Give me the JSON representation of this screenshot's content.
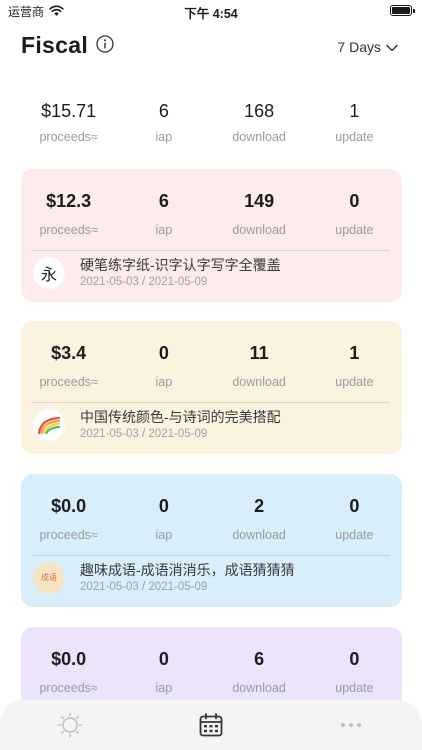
{
  "status_bar": {
    "carrier": "运营商",
    "time": "下午 4:54"
  },
  "header": {
    "title": "Fiscal",
    "range": "7 Days"
  },
  "summary": {
    "stats": [
      {
        "value": "$15.71",
        "label": "proceeds≈"
      },
      {
        "value": "6",
        "label": "iap"
      },
      {
        "value": "168",
        "label": "download"
      },
      {
        "value": "1",
        "label": "update"
      }
    ]
  },
  "apps": [
    {
      "name": "硬笔练字纸-识字认字写字全覆盖",
      "dates": "2021-05-03 / 2021-05-09",
      "icon_char": "永",
      "background": "#fdeceb",
      "stats": [
        {
          "value": "$12.3",
          "label": "proceeds≈"
        },
        {
          "value": "6",
          "label": "iap"
        },
        {
          "value": "149",
          "label": "download"
        },
        {
          "value": "0",
          "label": "update"
        }
      ]
    },
    {
      "name": "中国传统颜色-与诗词的完美搭配",
      "dates": "2021-05-03 / 2021-05-09",
      "icon_char": "",
      "background": "#fcf2e0",
      "stats": [
        {
          "value": "$3.4",
          "label": "proceeds≈"
        },
        {
          "value": "0",
          "label": "iap"
        },
        {
          "value": "11",
          "label": "download"
        },
        {
          "value": "1",
          "label": "update"
        }
      ]
    },
    {
      "name": "趣味成语-成语消消乐，成语猜猜猜",
      "dates": "2021-05-03 / 2021-05-09",
      "icon_char": "成语",
      "background": "#d8eefb",
      "stats": [
        {
          "value": "$0.0",
          "label": "proceeds≈"
        },
        {
          "value": "0",
          "label": "iap"
        },
        {
          "value": "2",
          "label": "download"
        },
        {
          "value": "0",
          "label": "update"
        }
      ]
    },
    {
      "name": "",
      "dates": "",
      "icon_char": "",
      "background": "#ebe4fb",
      "stats": [
        {
          "value": "$0.0",
          "label": "proceeds≈"
        },
        {
          "value": "0",
          "label": "iap"
        },
        {
          "value": "6",
          "label": "download"
        },
        {
          "value": "0",
          "label": "update"
        }
      ]
    }
  ],
  "tabbar": {
    "tabs": [
      {
        "icon": "sun-icon",
        "active": false
      },
      {
        "icon": "calendar-icon",
        "active": true
      },
      {
        "icon": "more-icon",
        "active": false
      }
    ]
  }
}
